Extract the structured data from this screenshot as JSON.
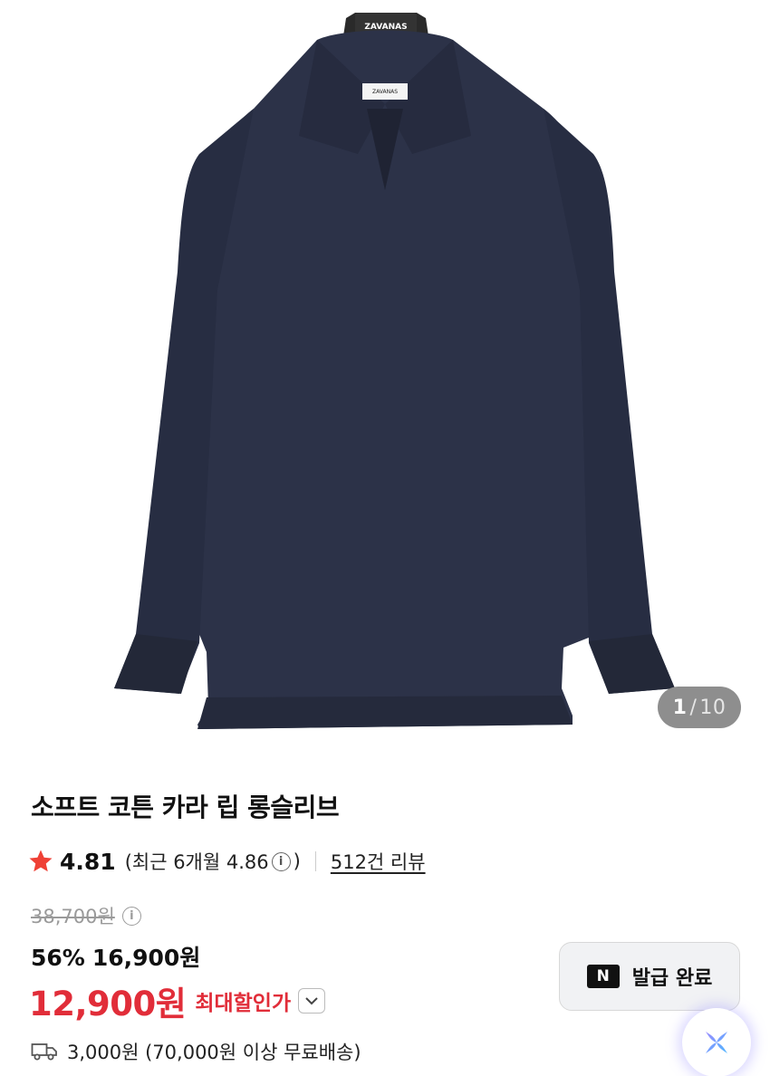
{
  "gallery": {
    "current": "1",
    "separator": "/",
    "total": "10",
    "hanger_brand": "ZAVANAS",
    "tag_brand": "ZAVANAS",
    "garment_color": "#2b3148"
  },
  "product": {
    "title": "소프트 코튼 카라 립 롱슬리브",
    "rating": "4.81",
    "recent_rating": "(최근 6개월 4.86",
    "recent_close": ")",
    "reviews": "512건 리뷰",
    "original_price": "38,700원",
    "discount": "56%",
    "sale_price": "16,900원",
    "max_price": "12,900원",
    "max_label": "최대할인가",
    "shipping": "3,000원 (70,000원 이상 무료배송)"
  },
  "coupon": {
    "badge": "N",
    "label": "발급 완료"
  },
  "icons": {
    "star": "star-icon",
    "info": "info-icon",
    "chevron": "chevron-down-icon",
    "truck": "truck-icon",
    "fab": "sparkle-icon"
  },
  "colors": {
    "accent": "#e12d39",
    "star": "#ef4136",
    "text": "#111111"
  }
}
